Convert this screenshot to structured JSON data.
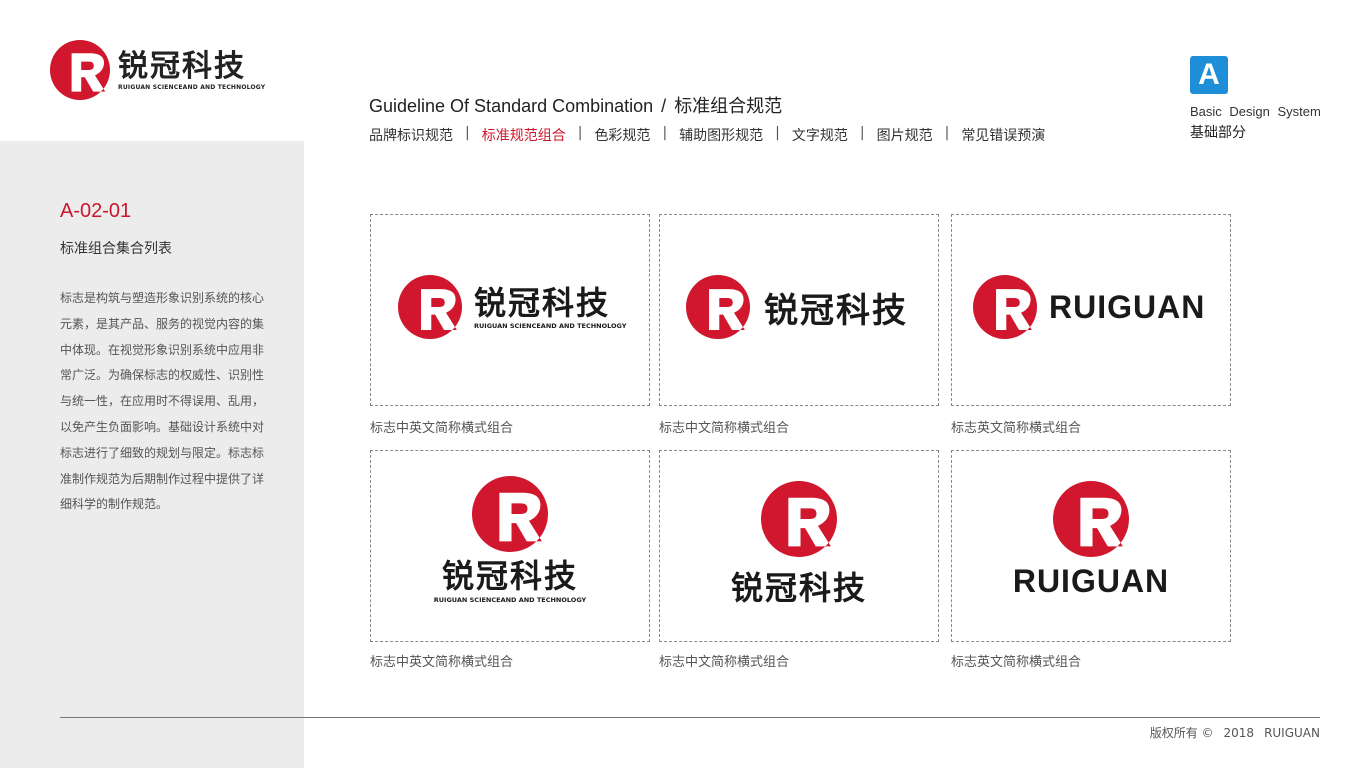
{
  "brand": {
    "name_cn": "锐冠科技",
    "name_en": "RUIGUAN SCIENCEAND AND TECHNOLOGY",
    "name_latin": "RUIGUAN",
    "accent": "#d0172d",
    "logo_icon": "r-circle-logo-icon"
  },
  "header": {
    "title_en": "Guideline Of Standard Combination",
    "separator": "/",
    "title_cn": "标准组合规范",
    "nav": [
      {
        "label": "品牌标识规范",
        "active": false
      },
      {
        "label": "标准规范组合",
        "active": true
      },
      {
        "label": "色彩规范",
        "active": false
      },
      {
        "label": "辅助图形规范",
        "active": false
      },
      {
        "label": "文字规范",
        "active": false
      },
      {
        "label": "图片规范",
        "active": false
      },
      {
        "label": "常见错误预演",
        "active": false
      }
    ],
    "nav_divider": "|"
  },
  "section": {
    "badge": "A",
    "badge_color": "#1e8ed8",
    "name_en": "Basic Design System",
    "name_cn": "基础部分"
  },
  "page": {
    "code": "A-02-01",
    "subtitle": "标准组合集合列表",
    "description": "标志是构筑与塑造形象识别系统的核心元素，是其产品、服务的视觉内容的集中体现。在视觉形象识别系统中应用非常广泛。为确保标志的权威性、识别性与统一性，在应用时不得误用、乱用，以免产生负面影响。基础设计系统中对标志进行了细致的规划与限定。标志标准制作规范为后期制作过程中提供了详细科学的制作规范。"
  },
  "combinations": [
    {
      "caption": "标志中英文简称横式组合"
    },
    {
      "caption": "标志中文简称横式组合"
    },
    {
      "caption": "标志英文简称横式组合"
    },
    {
      "caption": "标志中英文简称横式组合"
    },
    {
      "caption": "标志中文简称横式组合"
    },
    {
      "caption": "标志英文简称横式组合"
    }
  ],
  "footer": {
    "copyright": "版权所有 ©",
    "year": "2018",
    "company": "RUIGUAN"
  }
}
